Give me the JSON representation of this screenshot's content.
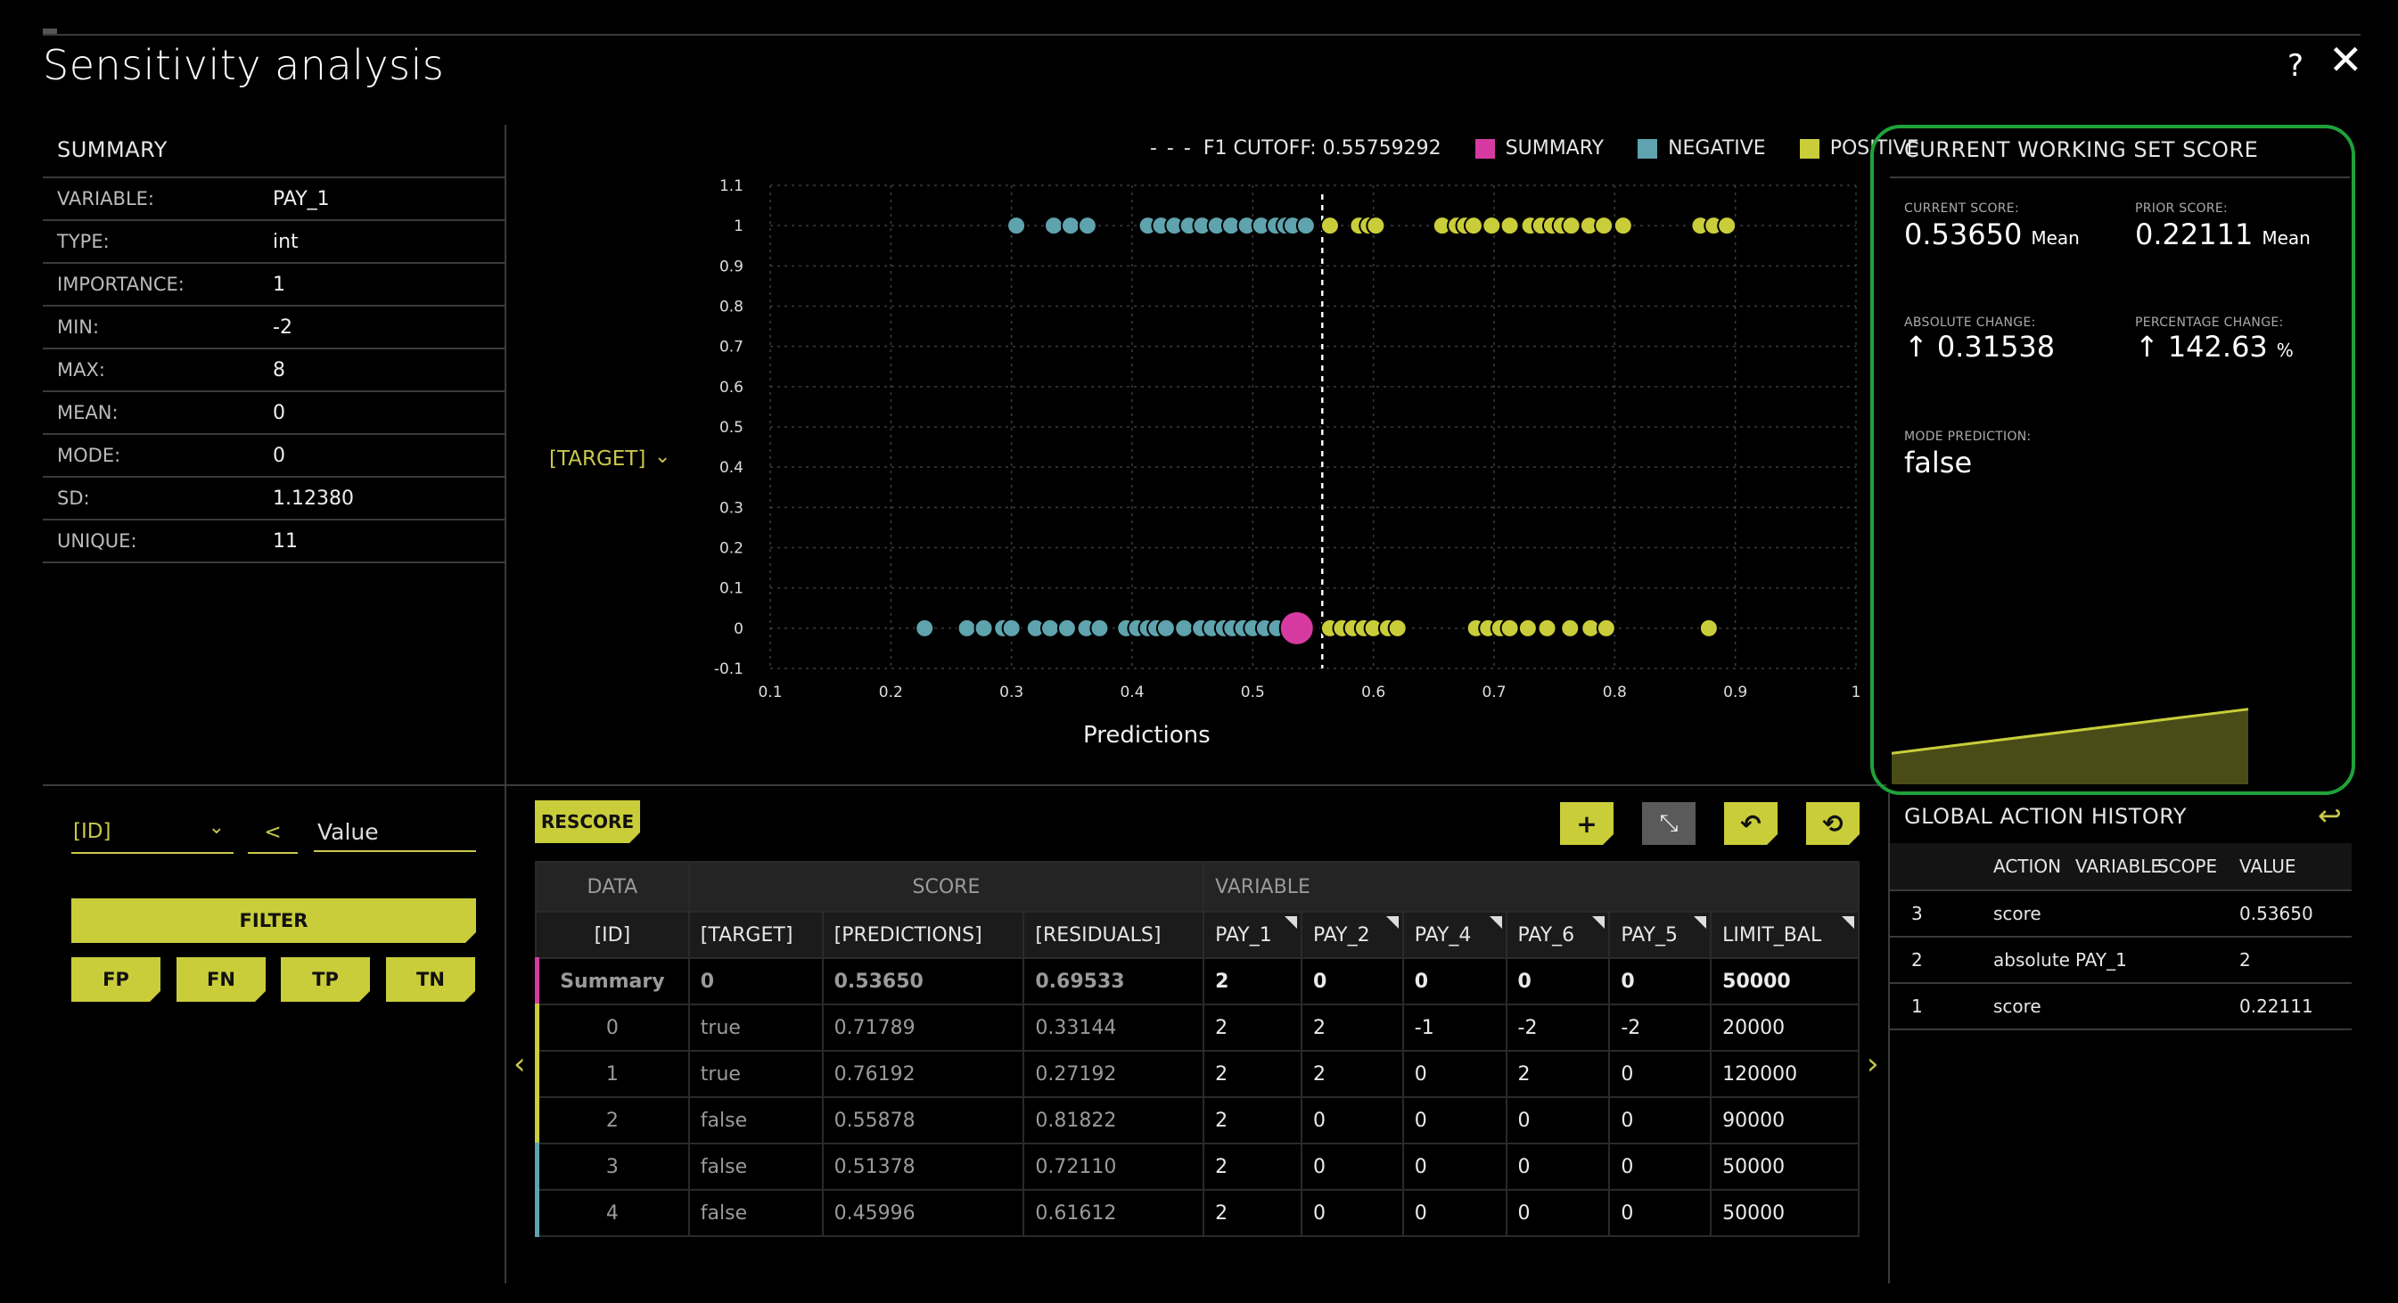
{
  "app": {
    "title": "Sensitivity analysis",
    "help": "?",
    "close": "✕"
  },
  "summary": {
    "title": "SUMMARY",
    "rows": [
      {
        "key": "VARIABLE:",
        "value": "PAY_1"
      },
      {
        "key": "TYPE:",
        "value": "int"
      },
      {
        "key": "IMPORTANCE:",
        "value": "1"
      },
      {
        "key": "MIN:",
        "value": "-2"
      },
      {
        "key": "MAX:",
        "value": "8"
      },
      {
        "key": "MEAN:",
        "value": "0"
      },
      {
        "key": "MODE:",
        "value": "0"
      },
      {
        "key": "SD:",
        "value": "1.12380"
      },
      {
        "key": "UNIQUE:",
        "value": "11"
      }
    ]
  },
  "legend": {
    "cutoff": "F1 CUTOFF: 0.55759292",
    "summary": "SUMMARY",
    "negative": "NEGATIVE",
    "positive": "POSITIVE"
  },
  "colors": {
    "summary": "#d63aa0",
    "negative": "#5ea3ad",
    "positive": "#c9cd3a",
    "accent": "#c9cd3a",
    "panel_border": "#1fa23a"
  },
  "y_selector": "[TARGET]",
  "chart_data": {
    "type": "scatter",
    "xlabel": "Predictions",
    "ylabel": "[TARGET]",
    "xlim": [
      0.1,
      1
    ],
    "ylim": [
      -0.1,
      1.1
    ],
    "xticks": [
      "0.1",
      "0.2",
      "0.3",
      "0.4",
      "0.5",
      "0.6",
      "0.7",
      "0.8",
      "0.9",
      "1"
    ],
    "yticks": [
      "1.1",
      "1",
      "0.9",
      "0.8",
      "0.7",
      "0.6",
      "0.5",
      "0.4",
      "0.3",
      "0.2",
      "0.1",
      "0",
      "-0.1"
    ],
    "cutoff": 0.5576,
    "grid": true,
    "series": [
      {
        "name": "NEGATIVE",
        "y": 1,
        "x": [
          0.304,
          0.335,
          0.349,
          0.363,
          0.413,
          0.424,
          0.435,
          0.447,
          0.458,
          0.47,
          0.482,
          0.495,
          0.507,
          0.519,
          0.527,
          0.533,
          0.544
        ]
      },
      {
        "name": "POSITIVE",
        "y": 1,
        "x": [
          0.564,
          0.588,
          0.596,
          0.602,
          0.657,
          0.669,
          0.676,
          0.683,
          0.698,
          0.713,
          0.73,
          0.739,
          0.748,
          0.756,
          0.764,
          0.779,
          0.791,
          0.807,
          0.871,
          0.882,
          0.893
        ]
      },
      {
        "name": "NEGATIVE",
        "y": 0,
        "x": [
          0.228,
          0.263,
          0.277,
          0.293,
          0.3,
          0.32,
          0.332,
          0.346,
          0.362,
          0.373,
          0.395,
          0.404,
          0.413,
          0.42,
          0.428,
          0.443,
          0.457,
          0.466,
          0.476,
          0.483,
          0.492,
          0.5,
          0.51,
          0.52
        ]
      },
      {
        "name": "POSITIVE",
        "y": 0,
        "x": [
          0.564,
          0.574,
          0.583,
          0.592,
          0.6,
          0.612,
          0.62,
          0.685,
          0.695,
          0.705,
          0.713,
          0.728,
          0.744,
          0.763,
          0.78,
          0.793,
          0.878
        ]
      },
      {
        "name": "SUMMARY",
        "y": 0,
        "x": [
          0.5365
        ]
      }
    ]
  },
  "score_panel": {
    "title": "CURRENT WORKING SET SCORE",
    "current_label": "CURRENT SCORE:",
    "current_value": "0.53650",
    "current_unit": "Mean",
    "prior_label": "PRIOR SCORE:",
    "prior_value": "0.22111",
    "prior_unit": "Mean",
    "abs_label": "ABSOLUTE CHANGE:",
    "abs_value": "0.31538",
    "pct_label": "PERCENTAGE CHANGE:",
    "pct_value": "142.63",
    "pct_unit": "%",
    "mode_label": "MODE PREDICTION:",
    "mode_value": "false",
    "trend": [
      0.22111,
      0.5365
    ]
  },
  "history": {
    "title": "GLOBAL ACTION HISTORY",
    "headers": [
      "",
      "ACTION",
      "VARIABLE",
      "SCOPE",
      "VALUE"
    ],
    "rows": [
      {
        "n": "3",
        "action": "score",
        "variable": "",
        "value": "0.53650"
      },
      {
        "n": "2",
        "action": "absolute",
        "variable": "PAY_1",
        "value": "2"
      },
      {
        "n": "1",
        "action": "score",
        "variable": "",
        "value": "0.22111"
      }
    ]
  },
  "filter": {
    "column": "[ID]",
    "operator": "<",
    "value_placeholder": "Value",
    "filter_label": "FILTER",
    "quick": [
      "FP",
      "FN",
      "TP",
      "TN"
    ]
  },
  "table": {
    "rescore": "RESCORE",
    "groups": [
      "DATA",
      "SCORE",
      "VARIABLE"
    ],
    "headers": [
      "[ID]",
      "[TARGET]",
      "[PREDICTIONS]",
      "[RESIDUALS]",
      "PAY_1",
      "PAY_2",
      "PAY_4",
      "PAY_6",
      "PAY_5",
      "LIMIT_BAL"
    ],
    "rows": [
      {
        "id": "Summary",
        "target": "0",
        "pred": "0.53650",
        "resid": "0.69533",
        "pay1": "2",
        "pay2": "0",
        "pay4": "0",
        "pay6": "0",
        "pay5": "0",
        "limit": "50000",
        "kind": "summary"
      },
      {
        "id": "0",
        "target": "true",
        "pred": "0.71789",
        "resid": "0.33144",
        "pay1": "2",
        "pay2": "2",
        "pay4": "-1",
        "pay6": "-2",
        "pay5": "-2",
        "limit": "20000",
        "kind": "positive"
      },
      {
        "id": "1",
        "target": "true",
        "pred": "0.76192",
        "resid": "0.27192",
        "pay1": "2",
        "pay2": "2",
        "pay4": "0",
        "pay6": "2",
        "pay5": "0",
        "limit": "120000",
        "kind": "positive"
      },
      {
        "id": "2",
        "target": "false",
        "pred": "0.55878",
        "resid": "0.81822",
        "pay1": "2",
        "pay2": "0",
        "pay4": "0",
        "pay6": "0",
        "pay5": "0",
        "limit": "90000",
        "kind": "positive"
      },
      {
        "id": "3",
        "target": "false",
        "pred": "0.51378",
        "resid": "0.72110",
        "pay1": "2",
        "pay2": "0",
        "pay4": "0",
        "pay6": "0",
        "pay5": "0",
        "limit": "50000",
        "kind": "negative"
      },
      {
        "id": "4",
        "target": "false",
        "pred": "0.45996",
        "resid": "0.61612",
        "pay1": "2",
        "pay2": "0",
        "pay4": "0",
        "pay6": "0",
        "pay5": "0",
        "limit": "50000",
        "kind": "negative"
      }
    ],
    "prev": "‹",
    "next": "›"
  }
}
